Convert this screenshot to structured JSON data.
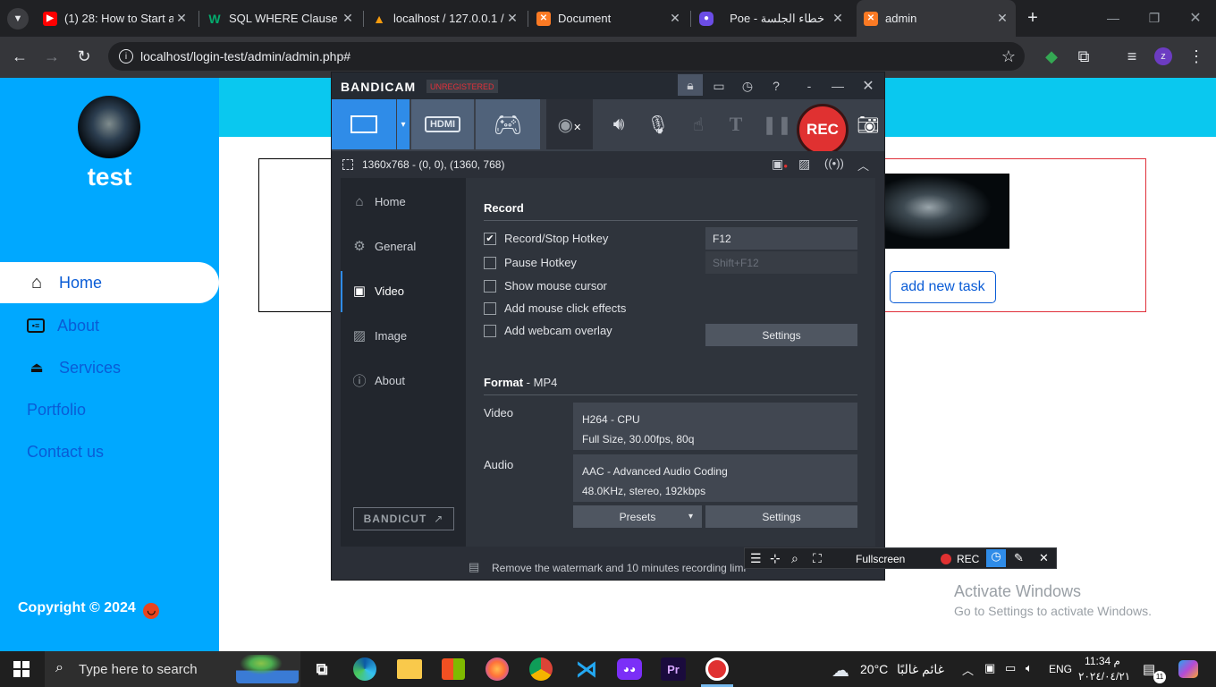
{
  "browser": {
    "tabs": [
      {
        "title": "(1) 28: How to Start a",
        "favicon": "youtube-icon"
      },
      {
        "title": "SQL WHERE Clause",
        "favicon": "w3schools-icon"
      },
      {
        "title": "localhost / 127.0.0.1 /",
        "favicon": "phpmyadmin-icon"
      },
      {
        "title": "Document",
        "favicon": "xampp-icon"
      },
      {
        "title": "Poe - خطاء الجلسة",
        "favicon": "poe-icon"
      },
      {
        "title": "admin",
        "favicon": "xampp-icon"
      }
    ],
    "active_tab": 5,
    "url": "localhost/login-test/admin/admin.php#",
    "profile_initial": "z"
  },
  "page": {
    "username": "test",
    "nav": [
      "Home",
      "About",
      "Services",
      "Portfolio",
      "Contact us"
    ],
    "copyright": "Copyright © 2024",
    "add_task_label": "add new task",
    "colors": {
      "sidebar": "#00a8ff",
      "header_band": "#0ac8ef",
      "link": "#0a5cd6"
    }
  },
  "bandicam": {
    "logo": "BANDICAM",
    "unregistered": "UNREGISTERED",
    "rec_label": "REC",
    "area_info": "1360x768 - (0, 0), (1360, 768)",
    "sidebar": [
      "Home",
      "General",
      "Video",
      "Image",
      "About"
    ],
    "active_section": "Video",
    "bandicut_label": "BANDICUT",
    "record": {
      "heading": "Record",
      "options": [
        {
          "label": "Record/Stop Hotkey",
          "checked": true
        },
        {
          "label": "Pause Hotkey",
          "checked": false
        },
        {
          "label": "Show mouse cursor",
          "checked": false
        },
        {
          "label": "Add mouse click effects",
          "checked": false
        },
        {
          "label": "Add webcam overlay",
          "checked": false
        }
      ],
      "record_hotkey": "F12",
      "pause_hotkey": "Shift+F12",
      "settings_label": "Settings"
    },
    "format": {
      "heading": "Format",
      "container": " - MP4",
      "video_label": "Video",
      "video_line1": "H264 - CPU",
      "video_line2": "Full Size, 30.00fps, 80q",
      "audio_label": "Audio",
      "audio_line1": "AAC - Advanced Audio Coding",
      "audio_line2": "48.0KHz, stereo, 192kbps",
      "presets_label": "Presets",
      "settings_label": "Settings"
    },
    "footer_msg": "Remove the watermark and 10 minutes recording limi",
    "float_bar": {
      "fullscreen": "Fullscreen",
      "rec": "REC"
    }
  },
  "watermark": {
    "line1": "Activate Windows",
    "line2": "Go to Settings to activate Windows."
  },
  "taskbar": {
    "search_placeholder": "Type here to search",
    "weather_temp": "20°C",
    "weather_desc": "غائم غالبًا",
    "language": "ENG",
    "time": "11:34 م",
    "date": "٢٠٢٤/٠٤/٢١",
    "notification_count": "11"
  }
}
